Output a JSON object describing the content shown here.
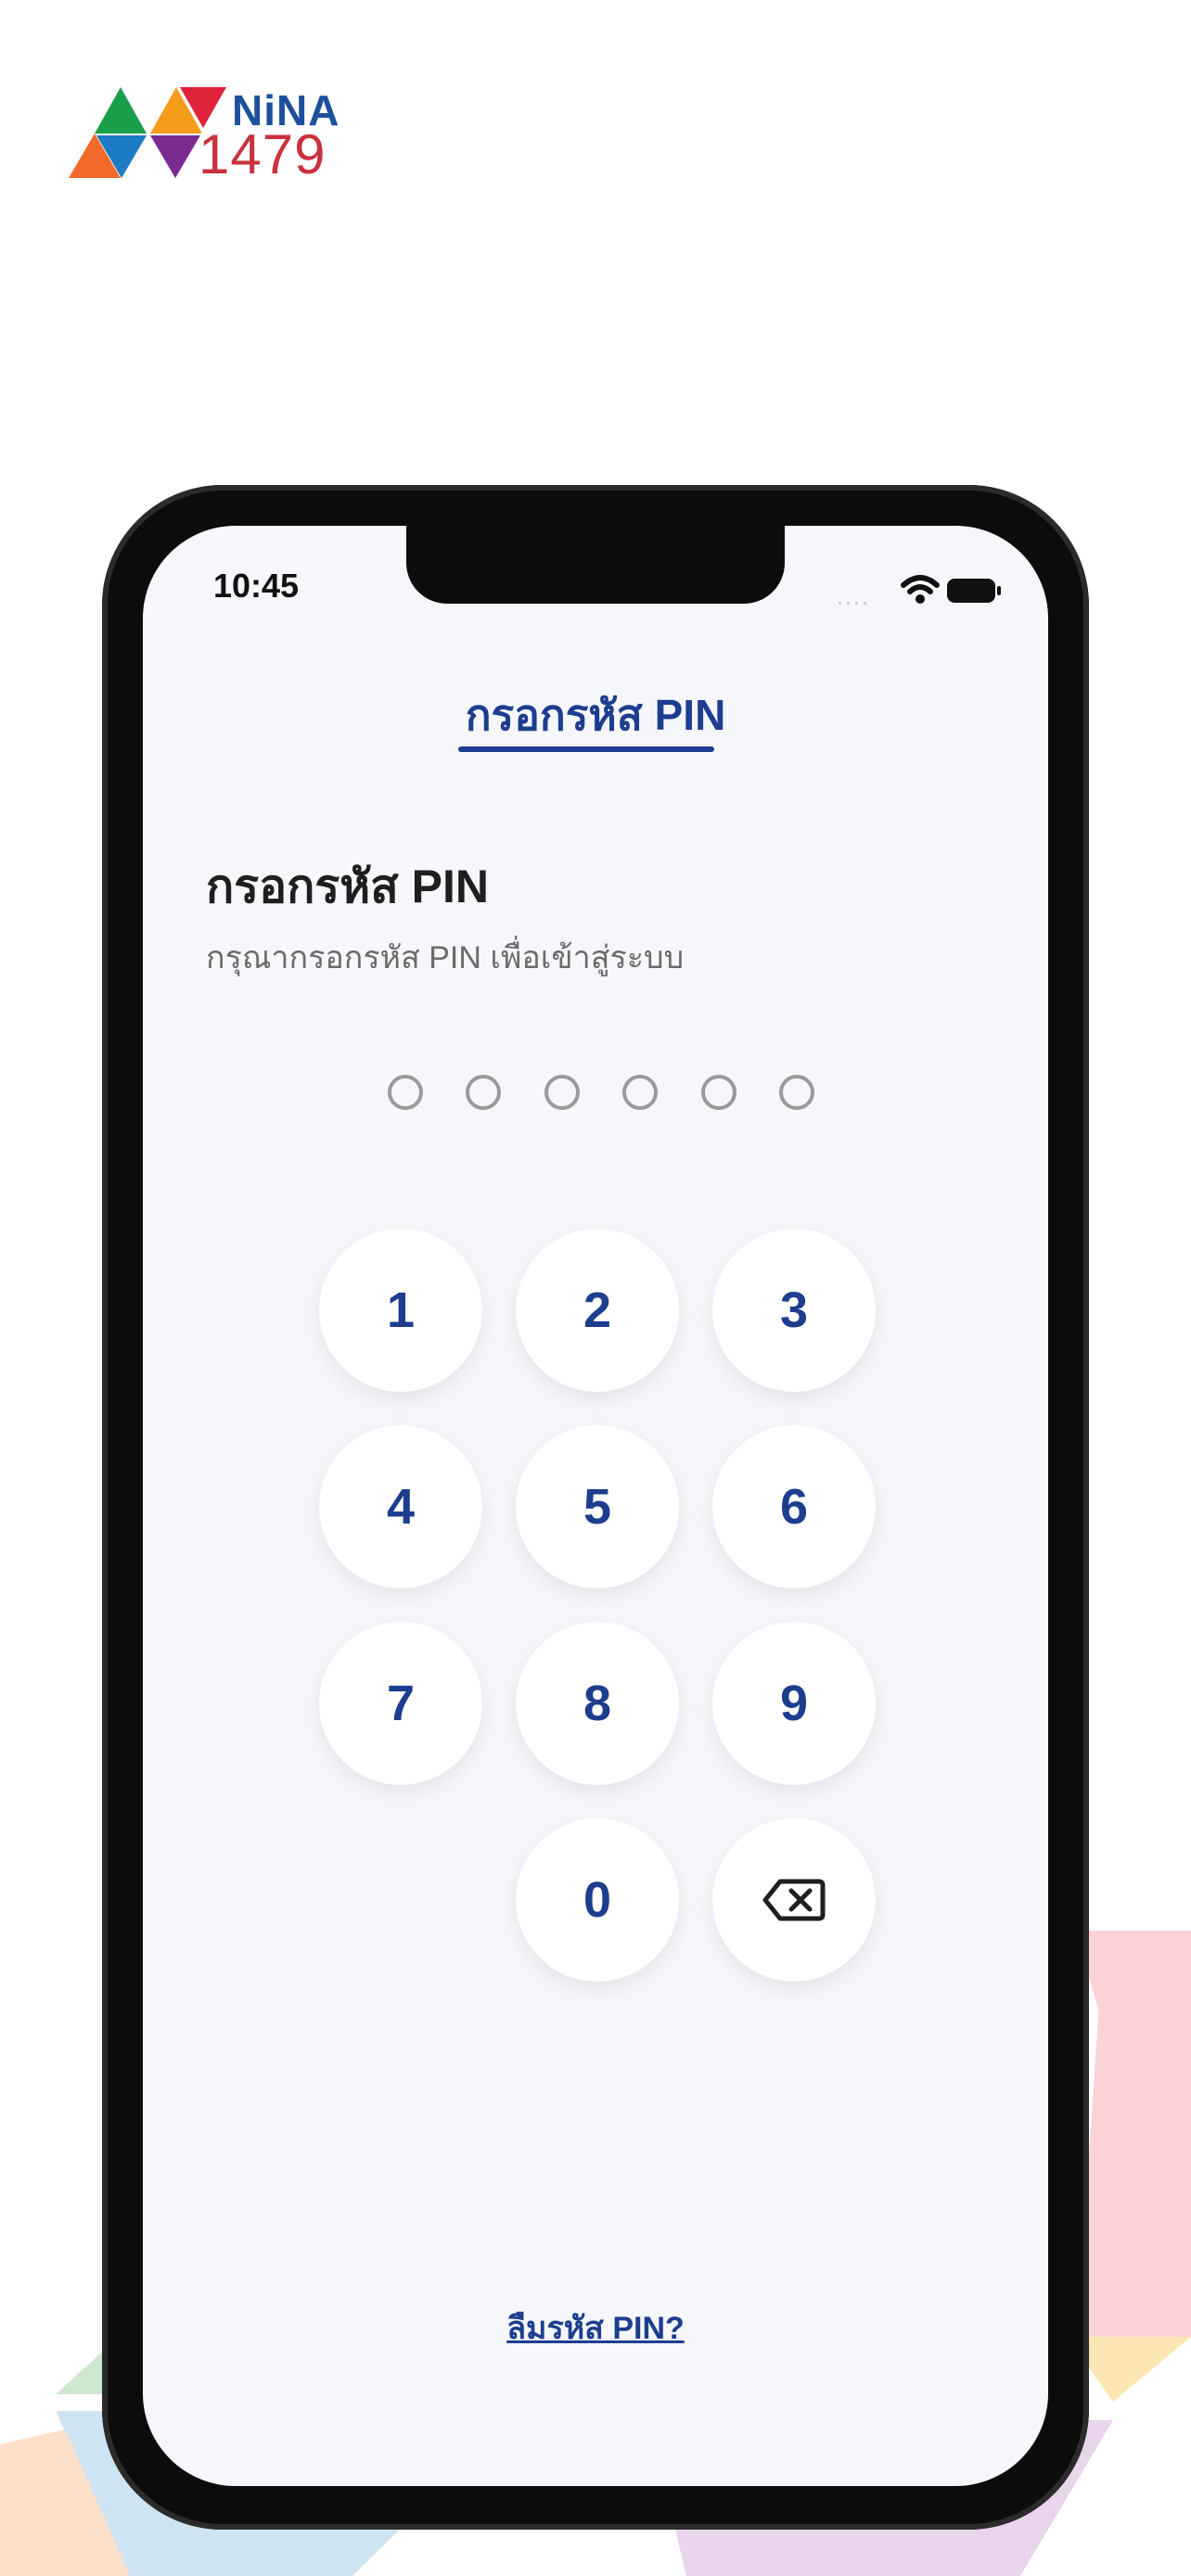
{
  "logo": {
    "name": "NiNA",
    "number": "1479",
    "colors": {
      "blue": "#1d4f9c",
      "red": "#c8323d",
      "green": "#1aa04a",
      "orange": "#f59c1a",
      "purple": "#6b2a8f"
    }
  },
  "status_bar": {
    "time": "10:45",
    "signal": "....",
    "wifi_icon": "wifi-icon",
    "battery_icon": "battery-icon"
  },
  "header": {
    "tab_title": "กรอกรหัส PIN"
  },
  "main": {
    "heading": "กรอกรหัส PIN",
    "subheading": "กรุณากรอกรหัส PIN เพื่อเข้าสู่ระบบ",
    "pin_length": 6,
    "pin_filled": 0
  },
  "keypad": {
    "keys": [
      "1",
      "2",
      "3",
      "4",
      "5",
      "6",
      "7",
      "8",
      "9",
      "0"
    ],
    "backspace_icon": "backspace-icon"
  },
  "footer": {
    "forgot_link": "ลืมรหัส PIN?"
  },
  "colors": {
    "accent": "#1d3d8f",
    "screen_bg": "#f6f7fb",
    "key_bg": "#ffffff"
  }
}
